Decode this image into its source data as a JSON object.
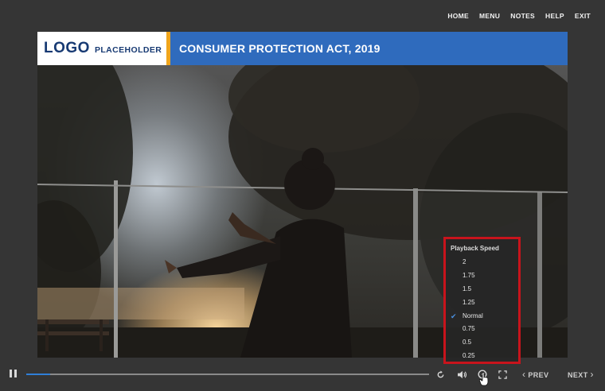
{
  "topnav": {
    "items": [
      "HOME",
      "MENU",
      "NOTES",
      "HELP",
      "EXIT"
    ]
  },
  "header": {
    "logo_main": "LOGO",
    "logo_sub": "PLACEHOLDER",
    "title": "CONSUMER PROTECTION ACT, 2019",
    "colors": {
      "bar": "#2f6bbd",
      "accent": "#f0a51c",
      "logo_text": "#173a73"
    }
  },
  "speed_menu": {
    "title": "Playback Speed",
    "options": [
      "2",
      "1.75",
      "1.5",
      "1.25",
      "Normal",
      "0.75",
      "0.5",
      "0.25"
    ],
    "selected": "Normal",
    "check_icon": "check-icon"
  },
  "player": {
    "progress": 0.06,
    "icons": {
      "play_pause": "pause-icon",
      "replay": "replay-icon",
      "volume": "volume-icon",
      "speed": "speed-icon",
      "fullscreen": "fullscreen-icon"
    },
    "prev_label": "PREV",
    "next_label": "NEXT"
  }
}
